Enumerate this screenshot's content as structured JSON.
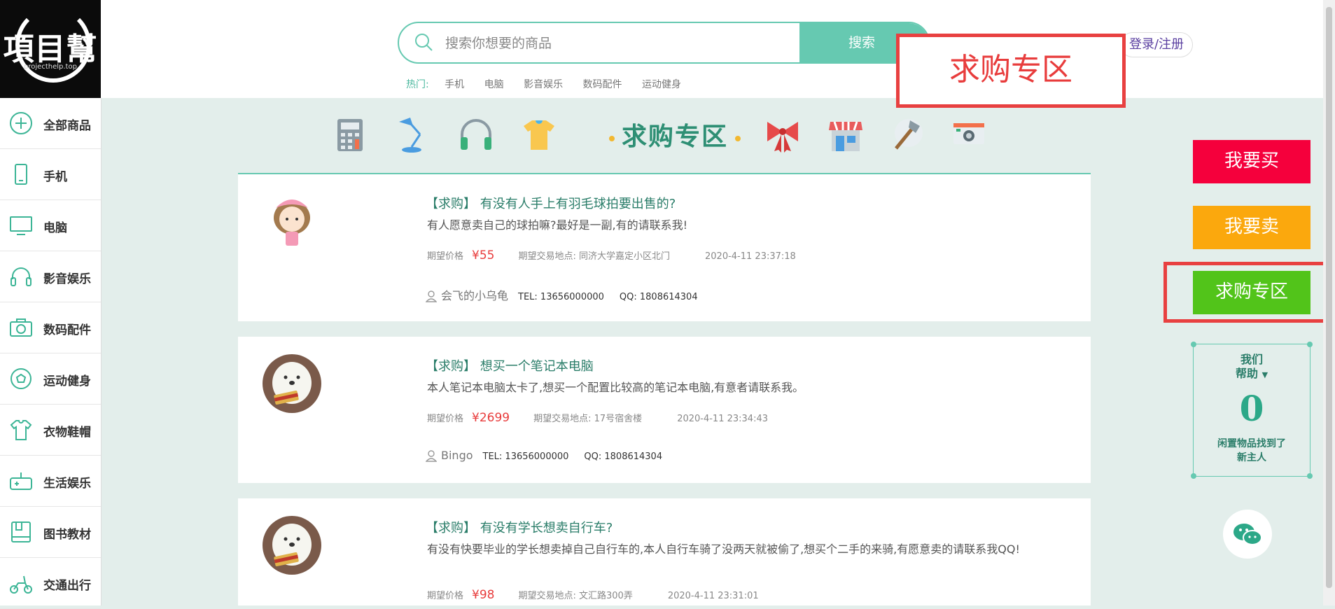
{
  "logo": {
    "brand": "項目幫",
    "site": "projecthelp.top"
  },
  "search": {
    "placeholder": "搜索你想要的商品",
    "button": "搜索",
    "hot_label": "热门:",
    "hot_links": [
      "手机",
      "电脑",
      "影音娱乐",
      "数码配件",
      "运动健身"
    ]
  },
  "header": {
    "login": "登录/注册"
  },
  "annotation_top": "求购专区",
  "sidebar": {
    "items": [
      {
        "label": "全部商品",
        "icon": "plus-circle-icon"
      },
      {
        "label": "手机",
        "icon": "phone-icon"
      },
      {
        "label": "电脑",
        "icon": "monitor-icon"
      },
      {
        "label": "影音娱乐",
        "icon": "headphones-icon"
      },
      {
        "label": "数码配件",
        "icon": "camera-icon"
      },
      {
        "label": "运动健身",
        "icon": "ball-icon"
      },
      {
        "label": "衣物鞋帽",
        "icon": "shirt-icon"
      },
      {
        "label": "生活娱乐",
        "icon": "gamepad-icon"
      },
      {
        "label": "图书教材",
        "icon": "book-icon"
      },
      {
        "label": "交通出行",
        "icon": "scooter-icon"
      }
    ]
  },
  "category_bar": {
    "title": "求购专区",
    "icons": [
      "calculator-icon",
      "desk-lamp-icon",
      "headphones-icon",
      "tshirt-icon",
      "bow-icon",
      "shop-icon",
      "tools-icon",
      "camera-icon"
    ]
  },
  "posts": [
    {
      "tag": "【求购】",
      "title": "有没有人手上有羽毛球拍要出售的?",
      "desc": "有人愿意卖自己的球拍嘛?最好是一副,有的请联系我!",
      "price_label": "期望价格",
      "price": "¥55",
      "place_label": "期望交易地点:",
      "place": "同济大学嘉定小区北门",
      "time": "2020-4-11 23:37:18",
      "user": "会飞的小乌龟",
      "tel": "TEL: 13656000000",
      "qq": "QQ: 1808614304",
      "avatar": "girl-avatar-icon"
    },
    {
      "tag": "【求购】",
      "title": "想买一个笔记本电脑",
      "desc": "本人笔记本电脑太卡了,想买一个配置比较高的笔记本电脑,有意者请联系我。",
      "price_label": "期望价格",
      "price": "¥2699",
      "place_label": "期望交易地点:",
      "place": "17号宿舍楼",
      "time": "2020-4-11 23:34:43",
      "user": "Bingo",
      "tel": "TEL: 13656000000",
      "qq": "QQ: 1808614304",
      "avatar": "bear-avatar-icon"
    },
    {
      "tag": "【求购】",
      "title": "有没有学长想卖自行车?",
      "desc": "有没有快要毕业的学长想卖掉自己自行车的,本人自行车骑了没两天就被偷了,想买个二手的来骑,有愿意卖的请联系我QQ!",
      "price_label": "期望价格",
      "price": "¥98",
      "place_label": "期望交易地点:",
      "place": "文汇路300弄",
      "time": "2020-4-11 23:31:01",
      "user": "",
      "tel": "",
      "qq": "",
      "avatar": "bear-avatar-icon"
    }
  ],
  "right": {
    "buy": "我要买",
    "sell": "我要卖",
    "wanted": "求购专区",
    "help_line1": "我们",
    "help_line2": "帮助",
    "help_count": "0",
    "help_line3": "闲置物品找到了",
    "help_line4": "新主人"
  },
  "colors": {
    "accent": "#66c9b1",
    "buy": "#f5003c",
    "sell": "#fba80d",
    "wanted": "#52c41a",
    "annotation": "#e84040",
    "price": "#e83c3c"
  }
}
